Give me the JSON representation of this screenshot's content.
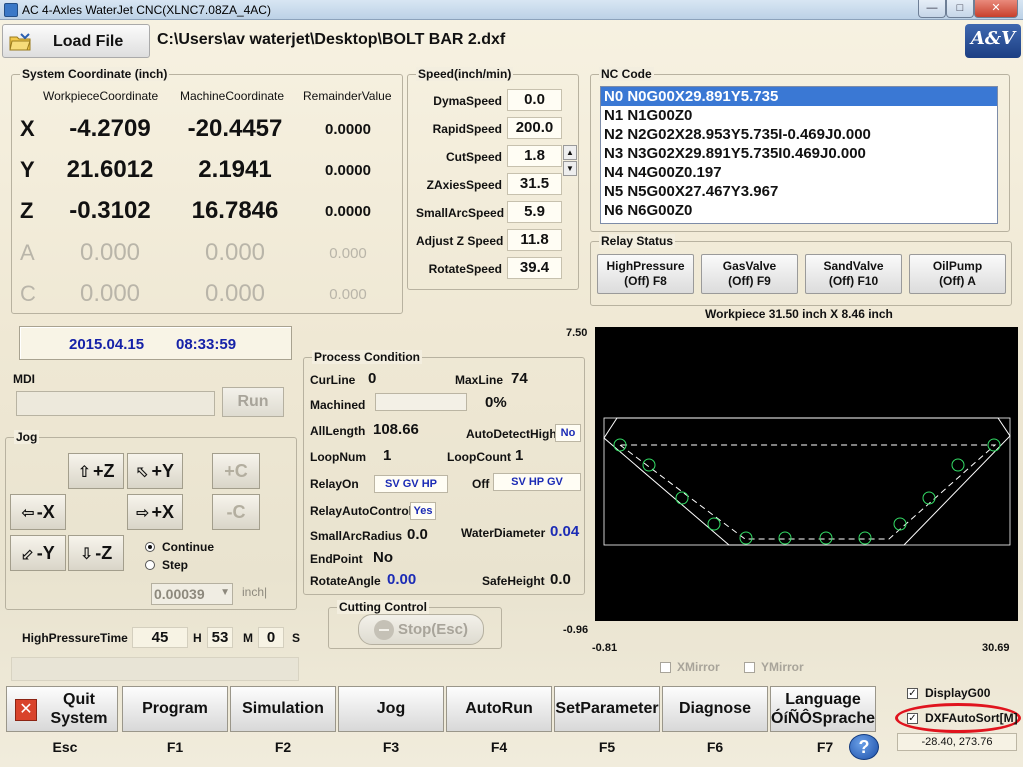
{
  "window": {
    "title": "AC 4-Axles WaterJet CNC(XLNC7.08ZA_4AC)"
  },
  "toolbar": {
    "load_file": "Load File",
    "file_path": "C:\\Users\\av waterjet\\Desktop\\BOLT BAR 2.dxf",
    "logo": "A&V"
  },
  "coord": {
    "title": "System Coordinate (inch)",
    "headers": [
      "WorkpieceCoordinate",
      "MachineCoordinate",
      "RemainderValue"
    ],
    "rows": [
      {
        "axis": "X",
        "workpiece": "-4.2709",
        "machine": "-20.4457",
        "remainder": "0.0000"
      },
      {
        "axis": "Y",
        "workpiece": "21.6012",
        "machine": "2.1941",
        "remainder": "0.0000"
      },
      {
        "axis": "Z",
        "workpiece": "-0.3102",
        "machine": "16.7846",
        "remainder": "0.0000"
      },
      {
        "axis": "A",
        "workpiece": "0.000",
        "machine": "0.000",
        "remainder": "0.000"
      },
      {
        "axis": "C",
        "workpiece": "0.000",
        "machine": "0.000",
        "remainder": "0.000"
      }
    ]
  },
  "speed": {
    "title": "Speed(inch/min)",
    "rows": [
      {
        "label": "DymaSpeed",
        "value": "0.0"
      },
      {
        "label": "RapidSpeed",
        "value": "200.0"
      },
      {
        "label": "CutSpeed",
        "value": "1.8"
      },
      {
        "label": "ZAxiesSpeed",
        "value": "31.5"
      },
      {
        "label": "SmallArcSpeed",
        "value": "5.9"
      },
      {
        "label": "Adjust Z Speed",
        "value": "11.8"
      },
      {
        "label": "RotateSpeed",
        "value": "39.4"
      }
    ]
  },
  "nc": {
    "title": "NC Code",
    "lines": [
      "N0 N0G00X29.891Y5.735",
      "N1 N1G00Z0",
      "N2 N2G02X28.953Y5.735I-0.469J0.000",
      "N3 N3G02X29.891Y5.735I0.469J0.000",
      "N4 N4G00Z0.197",
      "N5 N5G00X27.467Y3.967",
      "N6 N6G00Z0"
    ]
  },
  "relay": {
    "title": "Relay Status",
    "buttons": [
      {
        "name": "HighPressure",
        "state": "(Off) F8"
      },
      {
        "name": "GasValve",
        "state": "(Off) F9"
      },
      {
        "name": "SandValve",
        "state": "(Off) F10"
      },
      {
        "name": "OilPump",
        "state": "(Off) A"
      }
    ]
  },
  "datetime": {
    "date": "2015.04.15",
    "time": "08:33:59"
  },
  "mdi": {
    "title": "MDI",
    "run": "Run"
  },
  "jog": {
    "title": "Jog",
    "plus_z": "+Z",
    "plus_y": "+Y",
    "plus_c": "+C",
    "minus_x": "-X",
    "plus_x": "+X",
    "minus_c": "-C",
    "minus_y": "-Y",
    "minus_z": "-Z",
    "continue": "Continue",
    "step": "Step",
    "step_value": "0.00039",
    "unit": "inch|"
  },
  "hp_time": {
    "label": "HighPressureTime",
    "value": "45",
    "h": "H",
    "minutes": "53",
    "m": "M",
    "seconds": "0",
    "s": "S"
  },
  "process": {
    "title": "Process Condition",
    "curline_label": "CurLine",
    "curline": "0",
    "maxline_label": "MaxLine",
    "maxline": "74",
    "machined_label": "Machined",
    "machined_pct": "0%",
    "alllength_label": "AllLength",
    "alllength": "108.66",
    "autodetect_label": "AutoDetectHigh",
    "autodetect": "No",
    "loopnum_label": "LoopNum",
    "loopnum": "1",
    "loopcount_label": "LoopCount",
    "loopcount": "1",
    "relayon_label": "RelayOn",
    "relayon": "SV GV HP",
    "off_label": "Off",
    "off": "SV HP GV",
    "relayauto_label": "RelayAutoControl",
    "relayauto": "Yes",
    "smallarc_label": "SmallArcRadius",
    "smallarc": "0.0",
    "waterdia_label": "WaterDiameter",
    "waterdia": "0.04",
    "endpoint_label": "EndPoint",
    "endpoint": "No",
    "rotate_label": "RotateAngle",
    "rotate": "0.00",
    "safeheight_label": "SafeHeight",
    "safeheight": "0.0"
  },
  "cutting": {
    "title": "Cutting Control",
    "stop": "Stop(Esc)"
  },
  "preview": {
    "workpiece": "Workpiece 31.50 inch X 8.46 inch",
    "y_max": "7.50",
    "y_min": "-0.96",
    "x_min": "-0.81",
    "x_max": "30.69",
    "xmirror": "XMirror",
    "ymirror": "YMirror"
  },
  "options": {
    "display_g00": "DisplayG00",
    "dxf_autosort": "DXFAutoSort[M]",
    "coords": "-28.40,  273.76"
  },
  "menu": {
    "quit": "Quit System",
    "program": "Program",
    "simulation": "Simulation",
    "jog": "Jog",
    "autorun": "AutoRun",
    "setparameter": "SetParameter",
    "diagnose": "Diagnose",
    "language_line1": "Language",
    "language_line2": "ÓíÑÔSprache"
  },
  "fkeys": [
    "Esc",
    "F1",
    "F2",
    "F3",
    "F4",
    "F5",
    "F6",
    "F7"
  ],
  "colors": {
    "accent_blue": "#1622a8",
    "selection": "#3a78d4",
    "highlight_ring": "#e0141e"
  }
}
